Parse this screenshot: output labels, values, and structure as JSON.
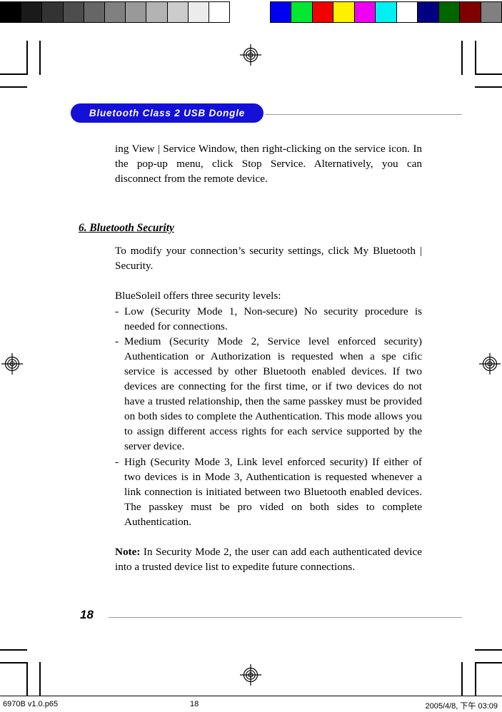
{
  "calibration": {
    "grayscale_label": "grayscale-calibration-bar",
    "grayscale_swatches": [
      "#000000",
      "#1a1a1a",
      "#333333",
      "#4d4d4d",
      "#666666",
      "#808080",
      "#999999",
      "#b3b3b3",
      "#cccccc",
      "#ececec",
      "#ffffff"
    ],
    "color_label": "color-calibration-bar",
    "color_swatches": [
      "#0000f0",
      "#00e832",
      "#f00000",
      "#fff000",
      "#f000f0",
      "#00f0f0",
      "#ffffff",
      "#000080",
      "#006600",
      "#800000",
      "#808080"
    ]
  },
  "header": {
    "title": "Bluetooth Class 2 USB Dongle",
    "pill_color": "#1410d8",
    "text_color": "#ffffff",
    "rule_color": "#9a9a9a"
  },
  "content": {
    "intro_paragraph": "ing View | Service Window, then right-clicking on the service icon. In the pop-up menu, click Stop Service. Alternatively, you can disconnect from the remote device.",
    "section_heading": "6. Bluetooth Security",
    "modify_paragraph": "To modify your connection’s security settings, click My Bluetooth | Security.",
    "levels_intro": "BlueSoleil offers three security levels:",
    "security_levels": [
      {
        "marker": "-",
        "text": "Low (Security Mode 1, Non-secure) No security procedure is needed for connections."
      },
      {
        "marker": "-",
        "text": "Medium (Security Mode 2, Service level enforced security) Authentication or Authorization is requested when a spe cific service is accessed by other Bluetooth enabled devices. If two devices are connecting for the first time, or if two devices do not have a trusted relationship, then the same passkey must be provided on both sides to complete the Authentication. This mode allows you to assign different access rights for each service supported by the server device."
      },
      {
        "marker": "-",
        "text": "High (Security Mode 3, Link level enforced security) If either of two devices is in Mode 3, Authentication is requested whenever a link connection is initiated between two Bluetooth enabled devices. The passkey must be pro vided on both sides to complete Authentication."
      }
    ],
    "note_label": "Note:",
    "note_text": " In Security Mode 2, the user can add each authenticated device into a trusted device list to expedite future connections."
  },
  "footer": {
    "page_number": "18",
    "rule_color": "#9a9a9a"
  },
  "status_bar": {
    "file_name": "6970B v1.0.p65",
    "page_number": "18",
    "timestamp": "2005/4/8, 下午 03:09"
  }
}
